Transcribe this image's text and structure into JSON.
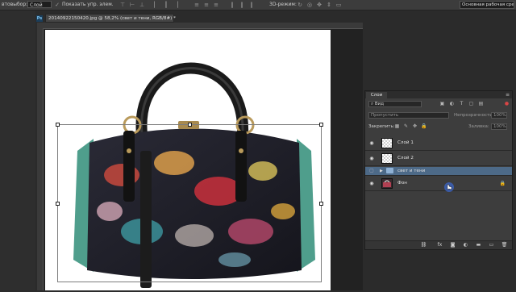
{
  "options_bar": {
    "autoselect_label": "втовыбор:",
    "autoselect_value": "Слой",
    "show_transform_label": "Показать упр. элем.",
    "mode_3d_label": "3D-режим:",
    "workspace_value": "Основная рабочая среда"
  },
  "document": {
    "tab_title": "20140922150420.jpg @ 58,2% (свет и тени, RGB/8#) *",
    "app_icon_text": "Ps"
  },
  "layers_panel": {
    "tab_label": "Слои",
    "filter_label": "Вид",
    "blend_mode": "Пропустить",
    "opacity_label": "Непрозрачность:",
    "opacity_value": "100%",
    "lock_label": "Закрепить:",
    "fill_label": "Заливка:",
    "fill_value": "100%",
    "layers": [
      {
        "name": "Слой 1",
        "type": "layer",
        "selected": false
      },
      {
        "name": "Слой 2",
        "type": "layer",
        "selected": false
      },
      {
        "name": "свет и тени",
        "type": "group",
        "selected": true
      },
      {
        "name": "Фон",
        "type": "background",
        "selected": false
      }
    ]
  },
  "icons": {
    "eye": "eye-icon",
    "folder": "folder-icon",
    "lock": "lock-icon",
    "link": "link-icon",
    "fx": "fx-icon",
    "mask": "mask-icon",
    "adjustment": "adjustment-icon",
    "new_group": "new-group-icon",
    "new_layer": "new-layer-icon",
    "trash": "trash-icon"
  },
  "colors": {
    "selected_layer": "#4d6a88",
    "panel_bg": "#3d3d3d",
    "canvas_bg": "#ffffff"
  }
}
